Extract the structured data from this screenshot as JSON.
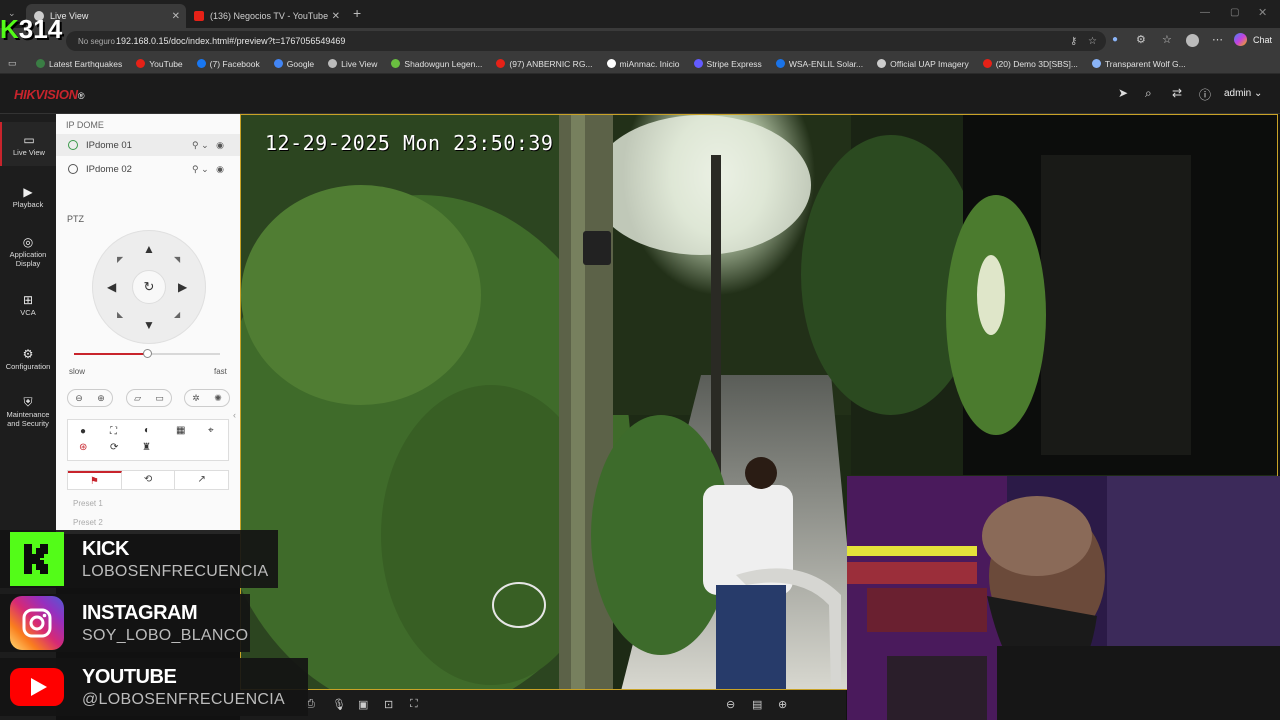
{
  "browser": {
    "tabs": [
      {
        "title": "Live View",
        "active": true
      },
      {
        "title": "(136) Negocios TV - YouTube",
        "active": false
      }
    ],
    "new_tab": "+",
    "security_label": "No seguro",
    "url": "192.168.0.15/doc/index.html#/preview?t=1767056549469",
    "chat_label": "Chat",
    "bookmarks": [
      {
        "label": "Latest Earthquakes",
        "color": "#3a7d44"
      },
      {
        "label": "YouTube",
        "color": "#e62117"
      },
      {
        "label": "(7) Facebook",
        "color": "#1877f2"
      },
      {
        "label": "Google",
        "color": "#4285f4"
      },
      {
        "label": "Live View",
        "color": "#bbbbbb"
      },
      {
        "label": "Shadowgun Legen...",
        "color": "#6abf40"
      },
      {
        "label": "(97) ANBERNIC RG...",
        "color": "#e62117"
      },
      {
        "label": "miAnmac. Inicio",
        "color": "#ffffff"
      },
      {
        "label": "Stripe Express",
        "color": "#635bff"
      },
      {
        "label": "WSA-ENLIL Solar...",
        "color": "#1a73e8"
      },
      {
        "label": "Official UAP Imagery",
        "color": "#cccccc"
      },
      {
        "label": "(20) Demo 3D[SBS]...",
        "color": "#e62117"
      },
      {
        "label": "Transparent Wolf G...",
        "color": "#8ab4f8"
      }
    ]
  },
  "app": {
    "logo": "HIKVISION",
    "logo_mark": "®",
    "user": "admin ⌄",
    "nav": [
      {
        "label": "Live View",
        "icon": "▭"
      },
      {
        "label": "Playback",
        "icon": "▶"
      },
      {
        "label": "Application Display",
        "icon": "◎"
      },
      {
        "label": "VCA",
        "icon": "⊞"
      },
      {
        "label": "Configuration",
        "icon": "⚙"
      },
      {
        "label": "Maintenance and Security",
        "icon": "⛨"
      }
    ],
    "panel": {
      "group_title": "IP DOME",
      "devices": [
        "IPdome 01",
        "IPdome 02"
      ],
      "ptz_label": "PTZ",
      "speed_slow": "slow",
      "speed_fast": "fast",
      "speed_level": 0.5,
      "presets": [
        "Preset 1",
        "Preset 2"
      ]
    }
  },
  "video": {
    "osd_timestamp": "12-29-2025 Mon 23:50:39"
  },
  "overlay": {
    "counter_prefix": "K",
    "counter": "314",
    "socials": [
      {
        "name": "KICK",
        "handle": "LOBOSENFRECUENCIA",
        "color": "#53fc18"
      },
      {
        "name": "INSTAGRAM",
        "handle": "SOY_LOBO_BLANCO",
        "color": "#d6249f"
      },
      {
        "name": "YOUTUBE",
        "handle": "@LOBOSENFRECUENCIA",
        "color": "#ff0000"
      }
    ]
  }
}
